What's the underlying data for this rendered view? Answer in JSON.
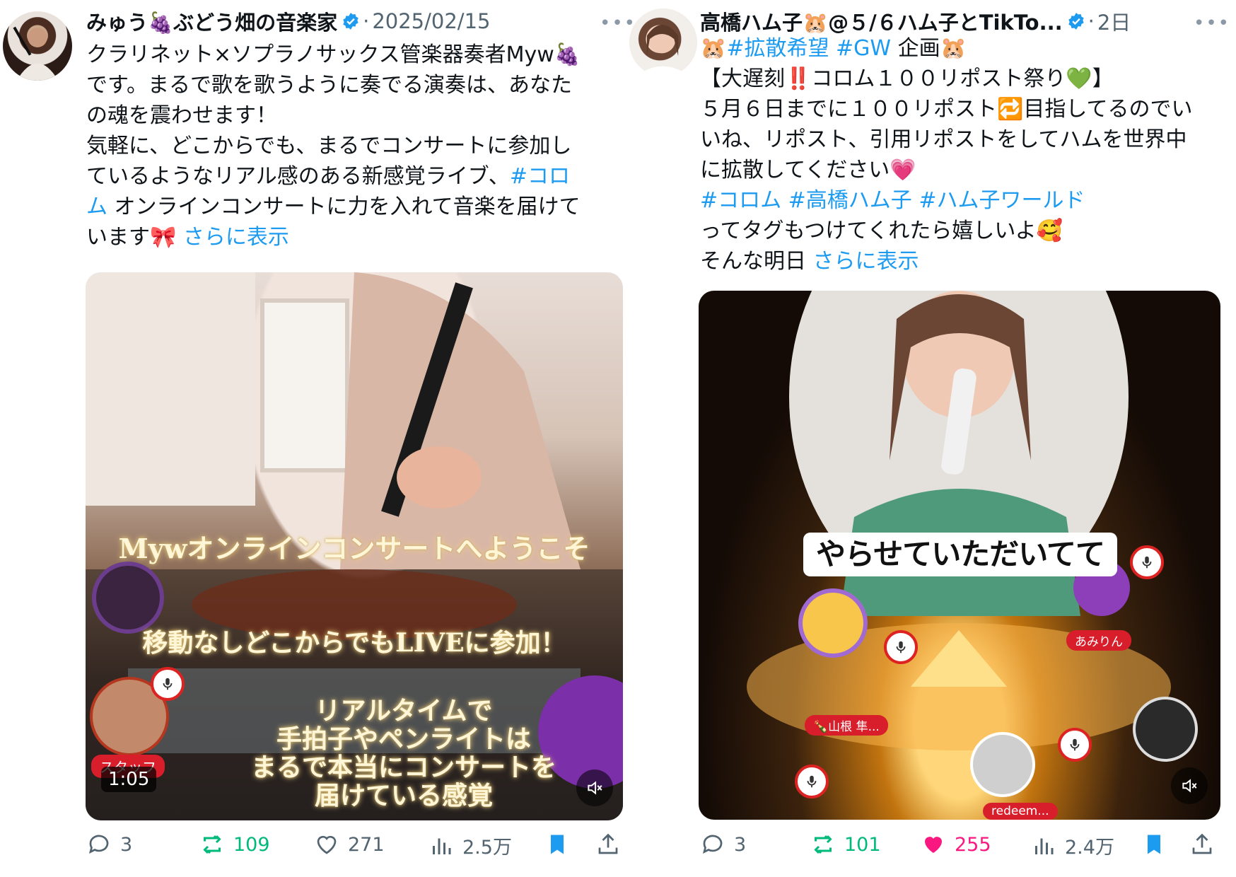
{
  "tweets": [
    {
      "author": "みゅう🍇ぶどう畑の音楽家",
      "separator": "·",
      "time": "2025/02/15",
      "text_lines": [
        "クラリネット×ソプラノサックス管楽器奏者Myw🍇",
        "です。まるで歌を歌うように奏でる演奏は、あなた",
        "の魂を震わせます！",
        "気軽に、どこからでも、まるでコンサートに参加し"
      ],
      "line5_pre": "ているようなリアル感のある新感覚ライブ、",
      "line5_tag": "#コロ",
      "line6_tag": "ム",
      "line6_post": " オンラインコンサートに力を入れて音楽を届けて",
      "line7_pre": "います🎀 ",
      "show_more": "さらに表示",
      "media": {
        "overlay_title": "Mywオンラインコンサートへようこそ",
        "overlay_sub": "移動なしどこからでもLIVEに参加！",
        "overlay_body": [
          "リアルタイムで",
          "手拍子やペンライトは",
          "まるで本当にコンサートを",
          "届けている感覚"
        ],
        "staff_label": "スタッフ",
        "duration": "1:05"
      },
      "stats": {
        "replies": "3",
        "reposts": "109",
        "likes": "271",
        "views": "2.5万"
      }
    },
    {
      "author": "高橋ハム子🐹@５/６ハム子とTikTo...",
      "separator": "·",
      "time": "2日",
      "line1_pre": "🐹",
      "line1_tags": "#拡散希望 #GW",
      "line1_post": " 企画🐹",
      "text_lines": [
        "【大遅刻‼️コロム１００リポスト祭り💚】",
        "５月６日までに１００リポスト🔁目指してるのでい",
        "いね、リポスト、引用リポストをしてハムを世界中",
        "に拡散してください💗"
      ],
      "hashtags_line": "#コロム #高橋ハム子 #ハム子ワールド",
      "text_after": "ってタグもつけてくれたら嬉しいよ🥰",
      "last_pre": "そんな明日 ",
      "show_more": "さらに表示",
      "media": {
        "caption": "やらせていただいてて",
        "user1": "あみりん",
        "user2": "🍾山根 隼...",
        "user3": "redeem..."
      },
      "stats": {
        "replies": "3",
        "reposts": "101",
        "likes": "255",
        "views": "2.4万"
      }
    }
  ],
  "colors": {
    "link": "#1d9bf0",
    "repost": "#00ba7c",
    "like": "#f91880",
    "bookmark": "#1d9bf0",
    "muted": "#536471"
  }
}
